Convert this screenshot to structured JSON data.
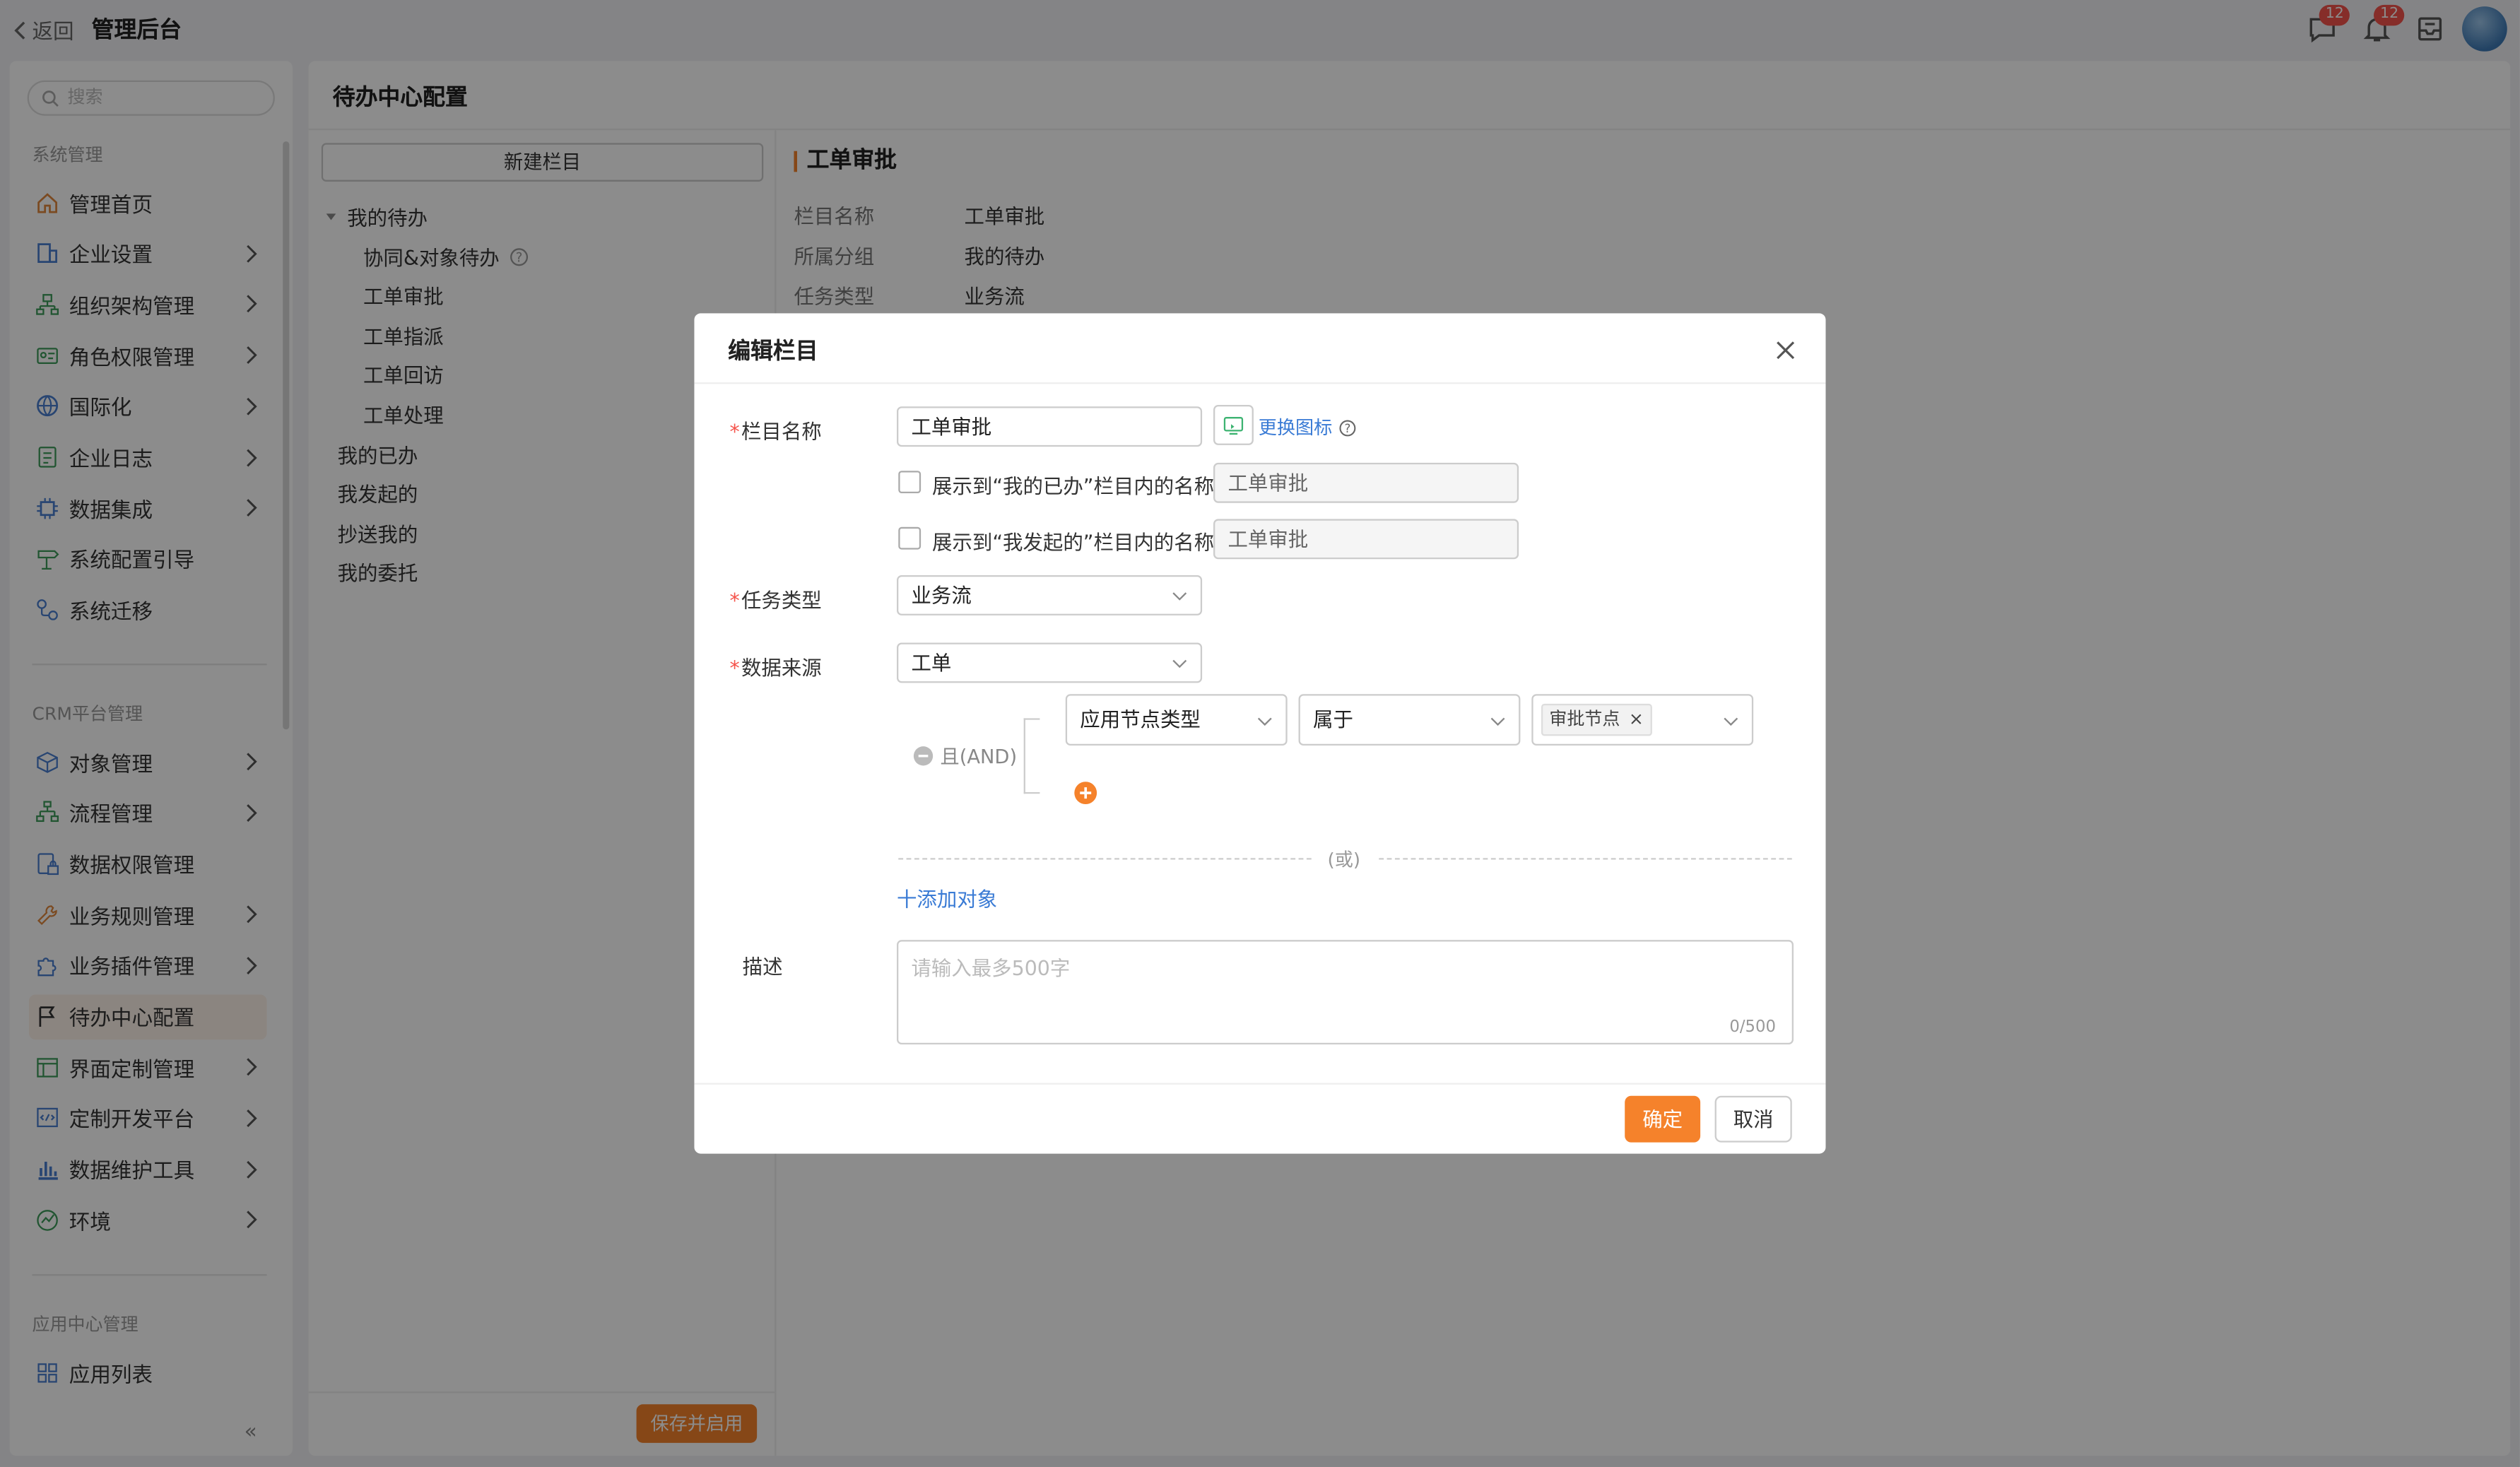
{
  "header": {
    "back_label": "返回",
    "app_title": "管理后台",
    "chat_badge": "12",
    "bell_badge": "12"
  },
  "sidebar": {
    "search_placeholder": "搜索",
    "group1": "系统管理",
    "items1": [
      {
        "label": "管理首页",
        "icon": "home-icon",
        "has_children": false
      },
      {
        "label": "企业设置",
        "icon": "building-icon",
        "has_children": true
      },
      {
        "label": "组织架构管理",
        "icon": "org-chart-icon",
        "has_children": true
      },
      {
        "label": "角色权限管理",
        "icon": "id-card-icon",
        "has_children": true
      },
      {
        "label": "国际化",
        "icon": "globe-icon",
        "has_children": true
      },
      {
        "label": "企业日志",
        "icon": "log-icon",
        "has_children": true
      },
      {
        "label": "数据集成",
        "icon": "chip-icon",
        "has_children": true
      },
      {
        "label": "系统配置引导",
        "icon": "signpost-icon",
        "has_children": false
      },
      {
        "label": "系统迁移",
        "icon": "migrate-icon",
        "has_children": false
      }
    ],
    "group2": "CRM平台管理",
    "items2": [
      {
        "label": "对象管理",
        "icon": "cube-icon",
        "has_children": true
      },
      {
        "label": "流程管理",
        "icon": "flow-icon",
        "has_children": true
      },
      {
        "label": "数据权限管理",
        "icon": "data-lock-icon",
        "has_children": false
      },
      {
        "label": "业务规则管理",
        "icon": "wrench-icon",
        "has_children": true
      },
      {
        "label": "业务插件管理",
        "icon": "puzzle-icon",
        "has_children": true
      },
      {
        "label": "待办中心配置",
        "icon": "flag-icon",
        "has_children": false,
        "active": true
      },
      {
        "label": "界面定制管理",
        "icon": "layout-icon",
        "has_children": true
      },
      {
        "label": "定制开发平台",
        "icon": "code-icon",
        "has_children": true
      },
      {
        "label": "数据维护工具",
        "icon": "bar-chart-icon",
        "has_children": true
      },
      {
        "label": "环境",
        "icon": "environment-icon",
        "has_children": true
      }
    ],
    "group3": "应用中心管理",
    "items3": [
      {
        "label": "应用列表",
        "icon": "grid-icon",
        "has_children": false
      }
    ]
  },
  "main": {
    "title": "待办中心配置",
    "new_column_label": "新建栏目",
    "tree": {
      "group_label": "我的待办",
      "children": [
        "协同&对象待办",
        "工单审批",
        "工单指派",
        "工单回访",
        "工单处理"
      ],
      "others": [
        "我的已办",
        "我发起的",
        "抄送我的",
        "我的委托"
      ]
    },
    "save_enable_label": "保存并启用",
    "detail": {
      "title": "工单审批",
      "rows": [
        {
          "label": "栏目名称",
          "value": "工单审批"
        },
        {
          "label": "所属分组",
          "value": "我的待办"
        },
        {
          "label": "任务类型",
          "value": "业务流"
        }
      ]
    }
  },
  "modal": {
    "title": "编辑栏目",
    "name_label": "栏目名称",
    "name_value": "工单审批",
    "change_icon_label": "更换图标",
    "show_done_label": "展示到“我的已办”栏目内的名称",
    "show_done_value": "工单审批",
    "show_initiated_label": "展示到“我发起的”栏目内的名称",
    "show_initiated_value": "工单审批",
    "task_type_label": "任务类型",
    "task_type_value": "业务流",
    "data_source_label": "数据来源",
    "data_source_value": "工单",
    "and_label": "且(AND)",
    "condition_field": "应用节点类型",
    "condition_operator": "属于",
    "condition_tag": "审批节点",
    "or_label": "(或)",
    "add_object_label": "十添加对象",
    "description_label": "描述",
    "description_placeholder": "请输入最多500字",
    "char_count": "0/500",
    "ok_label": "确定",
    "cancel_label": "取消"
  },
  "colors": {
    "accent": "#f5822b",
    "link": "#3a7bd5",
    "badge": "#f5534b"
  }
}
